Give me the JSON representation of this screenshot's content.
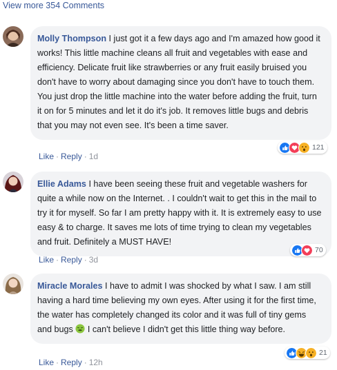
{
  "view_more": "View more 354 Comments",
  "comments": [
    {
      "author": "Molly Thompson",
      "text": "I just got it a few days ago and I'm amazed how good it works! This little machine cleans all fruit and vegetables with ease and efficiency. Delicate fruit like strawberries or any fruit easily bruised you don't have to worry about damaging since you don't have to touch them. You just drop the little machine into the water before adding the fruit, turn it on for 5 minutes and let it do it's job. It removes little bugs and debris that you may not even see. It's been a time saver.",
      "like": "Like",
      "reply": "Reply",
      "time": "1d",
      "reactions": [
        "like-reaction",
        "love-reaction",
        "wow-reaction"
      ],
      "reaction_count": "121"
    },
    {
      "author": "Ellie Adams",
      "text": "I have been seeing these fruit and vegetable washers for quite a while now on the Internet. . I couldn't wait to get this in the mail to try it for myself. So far I am pretty happy with it. It is extremely easy to use easy & to charge. It saves me lots of time trying to clean my vegetables and fruit. Definitely a MUST HAVE!",
      "like": "Like",
      "reply": "Reply",
      "time": "3d",
      "reactions": [
        "like-reaction",
        "love-reaction"
      ],
      "reaction_count": "70"
    },
    {
      "author": "Miracle Morales",
      "text_before_emoji": "I have to admit I was shocked by what I saw. I am still having a hard time believing my own eyes. After using it for the first time, the water has completely changed its color and it was full of tiny gems and bugs",
      "text_after_emoji": "I can't believe I didn't get this little thing way before.",
      "inline_emoji": "nauseated-face-emoji",
      "like": "Like",
      "reply": "Reply",
      "time": "12h",
      "reactions": [
        "like-reaction",
        "haha-reaction",
        "wow-reaction"
      ],
      "reaction_count": "21"
    }
  ],
  "colors": {
    "link": "#385898",
    "bubble": "#f2f3f5",
    "like_blue": "#1877f2",
    "love_red": "#f33e58",
    "reaction_yellow": "#f7b125"
  }
}
